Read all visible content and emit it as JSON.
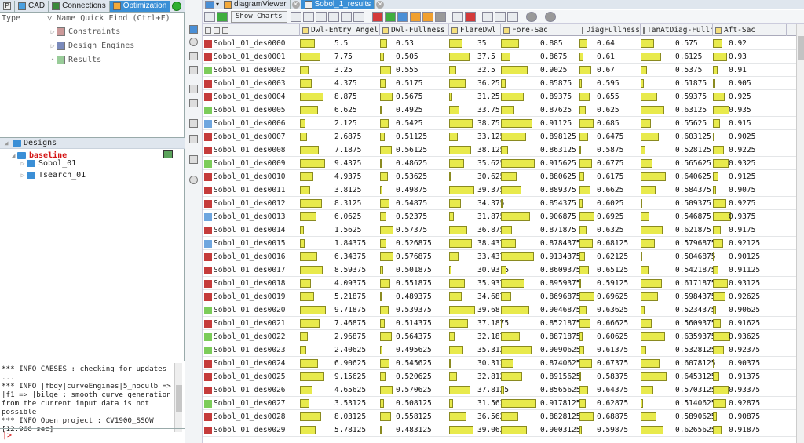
{
  "left_tabs": [
    "CAD",
    "Connections",
    "Optimization"
  ],
  "tree_header": {
    "type": "Type",
    "name": "Name",
    "find": "Quick Find (Ctrl+F)"
  },
  "tree_items": [
    "Constraints",
    "Design Engines",
    "Results"
  ],
  "designs": {
    "header": "Designs",
    "baseline": "baseline",
    "children": [
      "Sobol_01",
      "Tsearch_01"
    ]
  },
  "console_lines": "*** INFO CAESES : checking for updates ...\n*** INFO |fbdy|curveEngines|5_noculb => |f1 => |bilge : smooth curve generation from the current input data is not possible\n*** INFO Open project : CV1900_SSOW [12.966 sec]",
  "prompt": "|>",
  "doc_tabs": [
    "diagramViewer",
    "Sobol_1_results"
  ],
  "toolbar": {
    "show_charts": "Show Charts"
  },
  "columns": [
    "Dwl-Entry Angel",
    "Dwl-Fullness",
    "FlareDwl",
    "Fore-Sac",
    "DiagFullness",
    "TanAtDiag-Fulln",
    "Aft-Sac"
  ],
  "rows": [
    {
      "name": "Sobol_01_des0000",
      "status": "fail",
      "v": [
        "5.5",
        "0.53",
        "35",
        "0.885",
        "0.64",
        "0.575",
        "0.92"
      ]
    },
    {
      "name": "Sobol_01_des0001",
      "status": "fail",
      "v": [
        "7.75",
        "0.505",
        "37.5",
        "0.8675",
        "0.61",
        "0.6125",
        "0.93"
      ]
    },
    {
      "name": "Sobol_01_des0002",
      "status": "ok",
      "v": [
        "3.25",
        "0.555",
        "32.5",
        "0.9025",
        "0.67",
        "0.5375",
        "0.91"
      ]
    },
    {
      "name": "Sobol_01_des0003",
      "status": "fail",
      "v": [
        "4.375",
        "0.5175",
        "36.25",
        "0.85875",
        "0.595",
        "0.51875",
        "0.905"
      ]
    },
    {
      "name": "Sobol_01_des0004",
      "status": "fail",
      "v": [
        "8.875",
        "0.5675",
        "31.25",
        "0.89375",
        "0.655",
        "0.59375",
        "0.925"
      ]
    },
    {
      "name": "Sobol_01_des0005",
      "status": "ok",
      "v": [
        "6.625",
        "0.4925",
        "33.75",
        "0.87625",
        "0.625",
        "0.63125",
        "0.935"
      ]
    },
    {
      "name": "Sobol_01_des0006",
      "status": "feasible",
      "v": [
        "2.125",
        "0.5425",
        "38.75",
        "0.91125",
        "0.685",
        "0.55625",
        "0.915"
      ]
    },
    {
      "name": "Sobol_01_des0007",
      "status": "fail",
      "v": [
        "2.6875",
        "0.51125",
        "33.125",
        "0.898125",
        "0.6475",
        "0.603125",
        "0.9025"
      ]
    },
    {
      "name": "Sobol_01_des0008",
      "status": "fail",
      "v": [
        "7.1875",
        "0.56125",
        "38.125",
        "0.863125",
        "0.5875",
        "0.528125",
        "0.9225"
      ]
    },
    {
      "name": "Sobol_01_des0009",
      "status": "ok",
      "v": [
        "9.4375",
        "0.48625",
        "35.625",
        "0.915625",
        "0.6775",
        "0.565625",
        "0.9325"
      ]
    },
    {
      "name": "Sobol_01_des0010",
      "status": "fail",
      "v": [
        "4.9375",
        "0.53625",
        "30.625",
        "0.880625",
        "0.6175",
        "0.640625",
        "0.9125"
      ]
    },
    {
      "name": "Sobol_01_des0011",
      "status": "fail",
      "v": [
        "3.8125",
        "0.49875",
        "39.375",
        "0.889375",
        "0.6625",
        "0.584375",
        "0.9075"
      ]
    },
    {
      "name": "Sobol_01_des0012",
      "status": "fail",
      "v": [
        "8.3125",
        "0.54875",
        "34.375",
        "0.854375",
        "0.6025",
        "0.509375",
        "0.9275"
      ]
    },
    {
      "name": "Sobol_01_des0013",
      "status": "feasible",
      "v": [
        "6.0625",
        "0.52375",
        "31.875",
        "0.906875",
        "0.6925",
        "0.546875",
        "0.9375"
      ]
    },
    {
      "name": "Sobol_01_des0014",
      "status": "fail",
      "v": [
        "1.5625",
        "0.57375",
        "36.875",
        "0.871875",
        "0.6325",
        "0.621875",
        "0.9175"
      ]
    },
    {
      "name": "Sobol_01_des0015",
      "status": "feasible",
      "v": [
        "1.84375",
        "0.526875",
        "38.4375",
        "0.8784375",
        "0.68125",
        "0.5796875",
        "0.92125"
      ]
    },
    {
      "name": "Sobol_01_des0016",
      "status": "fail",
      "v": [
        "6.34375",
        "0.576875",
        "33.4375",
        "0.9134375",
        "0.62125",
        "0.5046875",
        "0.90125"
      ]
    },
    {
      "name": "Sobol_01_des0017",
      "status": "fail",
      "v": [
        "8.59375",
        "0.501875",
        "30.9375",
        "0.8609375",
        "0.65125",
        "0.5421875",
        "0.91125"
      ]
    },
    {
      "name": "Sobol_01_des0018",
      "status": "fail",
      "v": [
        "4.09375",
        "0.551875",
        "35.9375",
        "0.8959375",
        "0.59125",
        "0.6171875",
        "0.93125"
      ]
    },
    {
      "name": "Sobol_01_des0019",
      "status": "fail",
      "v": [
        "5.21875",
        "0.489375",
        "34.6875",
        "0.8696875",
        "0.69625",
        "0.5984375",
        "0.92625"
      ]
    },
    {
      "name": "Sobol_01_des0020",
      "status": "ok",
      "v": [
        "9.71875",
        "0.539375",
        "39.6875",
        "0.9046875",
        "0.63625",
        "0.5234375",
        "0.90625"
      ]
    },
    {
      "name": "Sobol_01_des0021",
      "status": "fail",
      "v": [
        "7.46875",
        "0.514375",
        "37.1875",
        "0.8521875",
        "0.66625",
        "0.5609375",
        "0.91625"
      ]
    },
    {
      "name": "Sobol_01_des0022",
      "status": "ok",
      "v": [
        "2.96875",
        "0.564375",
        "32.1875",
        "0.8871875",
        "0.60625",
        "0.6359375",
        "0.93625"
      ]
    },
    {
      "name": "Sobol_01_des0023",
      "status": "ok",
      "v": [
        "2.40625",
        "0.495625",
        "35.3125",
        "0.9090625",
        "0.61375",
        "0.5328125",
        "0.92375"
      ]
    },
    {
      "name": "Sobol_01_des0024",
      "status": "fail",
      "v": [
        "6.90625",
        "0.545625",
        "30.3125",
        "0.8740625",
        "0.67375",
        "0.6078125",
        "0.90375"
      ]
    },
    {
      "name": "Sobol_01_des0025",
      "status": "fail",
      "v": [
        "9.15625",
        "0.520625",
        "32.8125",
        "0.8915625",
        "0.58375",
        "0.6453125",
        "0.91375"
      ]
    },
    {
      "name": "Sobol_01_des0026",
      "status": "fail",
      "v": [
        "4.65625",
        "0.570625",
        "37.8125",
        "0.8565625",
        "0.64375",
        "0.5703125",
        "0.93375"
      ]
    },
    {
      "name": "Sobol_01_des0027",
      "status": "ok",
      "v": [
        "3.53125",
        "0.508125",
        "31.5625",
        "0.9178125",
        "0.62875",
        "0.5140625",
        "0.92875"
      ]
    },
    {
      "name": "Sobol_01_des0028",
      "status": "fail",
      "v": [
        "8.03125",
        "0.558125",
        "36.5625",
        "0.8828125",
        "0.68875",
        "0.5890625",
        "0.90875"
      ]
    },
    {
      "name": "Sobol_01_des0029",
      "status": "fail",
      "v": [
        "5.78125",
        "0.483125",
        "39.0625",
        "0.9003125",
        "0.59875",
        "0.6265625",
        "0.91875"
      ]
    }
  ],
  "col_ranges": [
    [
      0,
      10
    ],
    [
      0.48,
      0.58
    ],
    [
      30,
      40
    ],
    [
      0.85,
      0.92
    ],
    [
      0.58,
      0.7
    ],
    [
      0.5,
      0.65
    ],
    [
      0.9,
      0.94
    ]
  ],
  "colors": {
    "bar": "#e8ea4c",
    "accent": "#3a8fd6",
    "fail": "#c53b3b",
    "ok": "#7ccc5a",
    "feasible": "#6fa6df"
  }
}
